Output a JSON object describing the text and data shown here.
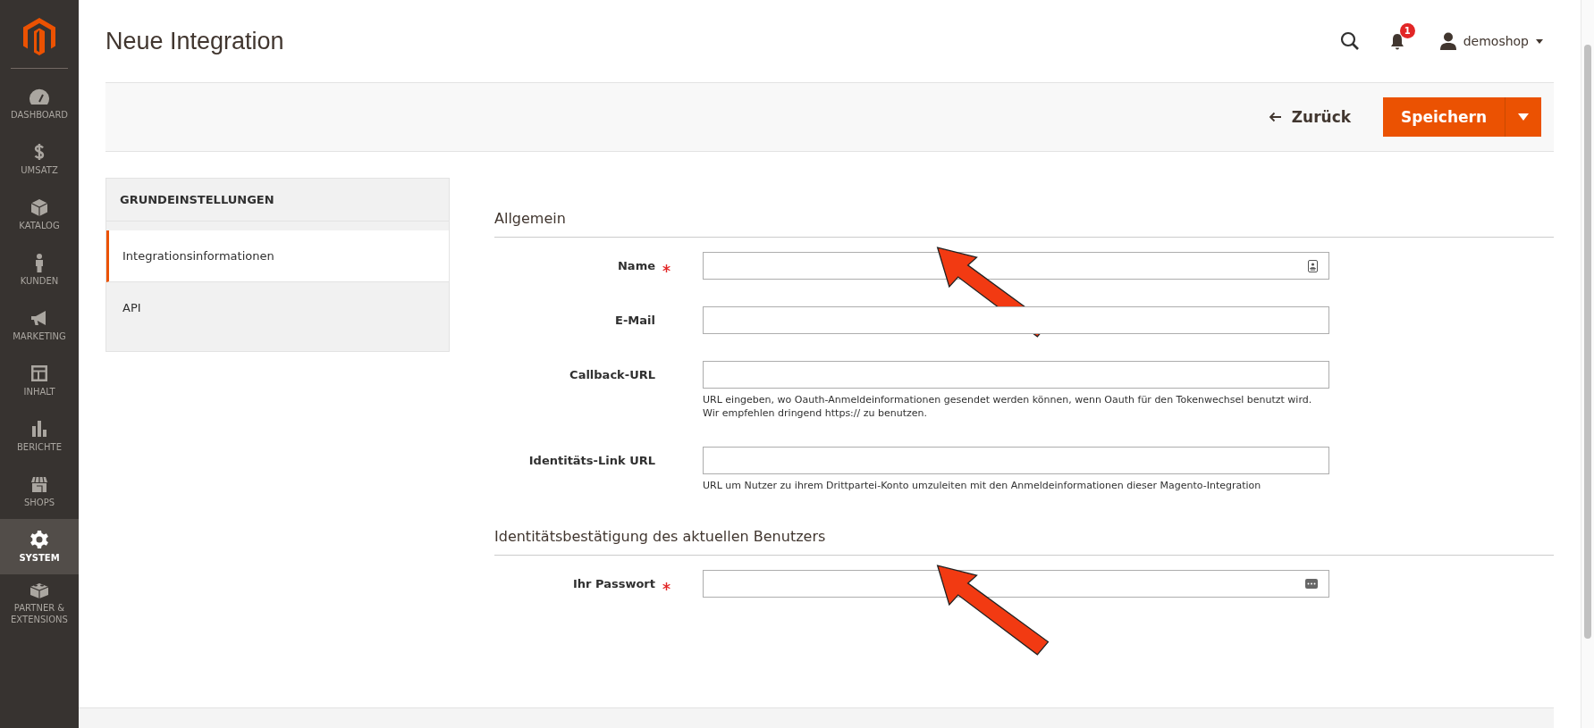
{
  "sidebar": {
    "items": [
      {
        "label": "DASHBOARD",
        "selected": false
      },
      {
        "label": "UMSATZ",
        "selected": false
      },
      {
        "label": "KATALOG",
        "selected": false
      },
      {
        "label": "KUNDEN",
        "selected": false
      },
      {
        "label": "MARKETING",
        "selected": false
      },
      {
        "label": "INHALT",
        "selected": false
      },
      {
        "label": "BERICHTE",
        "selected": false
      },
      {
        "label": "SHOPS",
        "selected": false
      },
      {
        "label": "SYSTEM",
        "selected": true
      },
      {
        "label": "PARTNER & EXTENSIONS",
        "selected": false
      }
    ]
  },
  "header": {
    "title": "Neue Integration",
    "notification_count": "1",
    "user": "demoshop"
  },
  "actions": {
    "back": "Zurück",
    "save": "Speichern"
  },
  "tabs": {
    "title": "GRUNDEINSTELLUNGEN",
    "items": [
      {
        "label": "Integrationsinformationen",
        "selected": true
      },
      {
        "label": "API",
        "selected": false
      }
    ]
  },
  "sections": [
    {
      "title": "Allgemein",
      "fields": [
        {
          "label": "Name",
          "required": true,
          "kind": "contact",
          "marked": true
        },
        {
          "label": "E-Mail",
          "required": false,
          "kind": "plain",
          "marked": false
        },
        {
          "label": "Callback-URL",
          "required": false,
          "kind": "plain",
          "marked": false,
          "note": [
            "URL eingeben, wo Oauth-Anmeldeinformationen gesendet werden können, wenn Oauth für den Tokenwechsel benutzt wird.",
            "Wir empfehlen dringend https:// zu benutzen."
          ]
        },
        {
          "label": "Identitäts-Link URL",
          "required": false,
          "kind": "plain",
          "marked": false,
          "note": [
            "URL um Nutzer zu ihrem Drittpartei-Konto umzuleiten mit den Anmeldeinformationen dieser Magento-Integration"
          ]
        }
      ]
    },
    {
      "title": "Identitätsbestätigung des aktuellen Benutzers",
      "fields": [
        {
          "label": "Ihr Passwort",
          "required": true,
          "kind": "password",
          "marked": true
        }
      ]
    }
  ]
}
